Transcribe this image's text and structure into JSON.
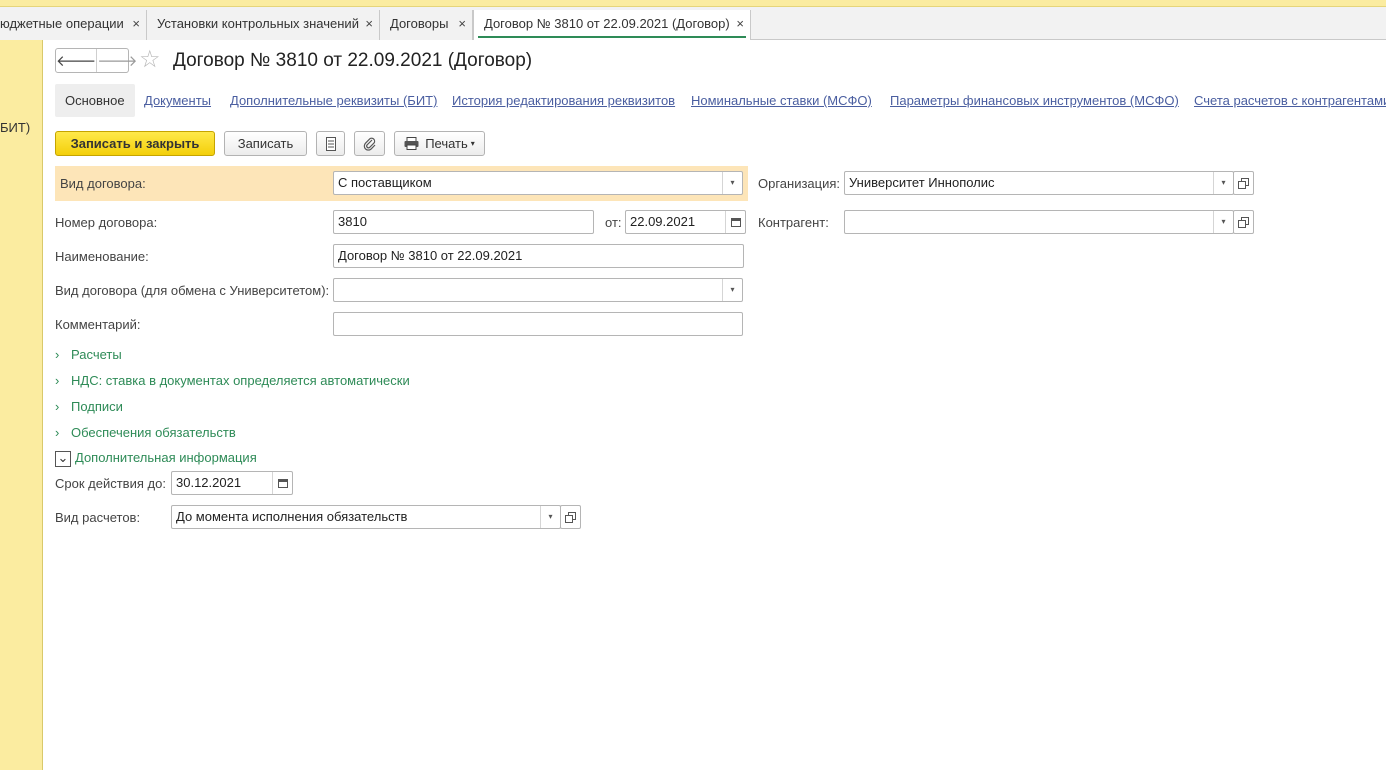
{
  "tabs": [
    {
      "label": "юджетные операции",
      "close": "×"
    },
    {
      "label": "Установки контрольных значений",
      "close": "×"
    },
    {
      "label": "Договоры",
      "close": "×"
    },
    {
      "label": "Договор № 3810 от 22.09.2021 (Договор)",
      "close": "×"
    }
  ],
  "left_panel": {
    "label": "БИТ)"
  },
  "header": {
    "back": "🡐",
    "forward": "🡒",
    "star": "☆",
    "title": "Договор № 3810 от 22.09.2021 (Договор)"
  },
  "sections": [
    "Основное",
    "Документы",
    "Дополнительные реквизиты (БИТ)",
    "История редактирования реквизитов",
    "Номинальные ставки (МСФО)",
    "Параметры финансовых инструментов (МСФО)",
    "Счета расчетов с контрагентами"
  ],
  "toolbar": {
    "save_close": "Записать и закрыть",
    "save": "Записать",
    "print": "Печать"
  },
  "form": {
    "contract_type_label": "Вид договора:",
    "contract_type_value": "С поставщиком",
    "number_label": "Номер договора:",
    "number_value": "3810",
    "date_label": "от:",
    "date_value": "22.09.2021",
    "name_label": "Наименование:",
    "name_value": "Договор № 3810 от 22.09.2021",
    "exchange_type_label": "Вид договора (для обмена с Университетом):",
    "exchange_type_value": "",
    "comment_label": "Комментарий:",
    "comment_value": "",
    "org_label": "Организация:",
    "org_value": "Университет Иннополис",
    "counterparty_label": "Контрагент:",
    "counterparty_value": ""
  },
  "groups": [
    {
      "label": "Расчеты",
      "chev": "›"
    },
    {
      "label": "НДС: ставка в документах определяется автоматически",
      "chev": "›"
    },
    {
      "label": "Подписи",
      "chev": "›"
    },
    {
      "label": "Обеспечения обязательств",
      "chev": "›"
    },
    {
      "label": "Дополнительная информация",
      "chev": "⌄"
    }
  ],
  "extra": {
    "valid_until_label": "Срок действия до:",
    "valid_until_value": "30.12.2021",
    "settlement_type_label": "Вид расчетов:",
    "settlement_type_value": "До момента исполнения обязательств"
  },
  "dropdown_glyph": "▾",
  "colors": {
    "accent_green": "#2e8b57",
    "link_blue": "#4a5ea0",
    "yellow_panel": "#fbeca0",
    "primary_button": "#f3cf0a",
    "highlight_row": "#fde5b8"
  }
}
